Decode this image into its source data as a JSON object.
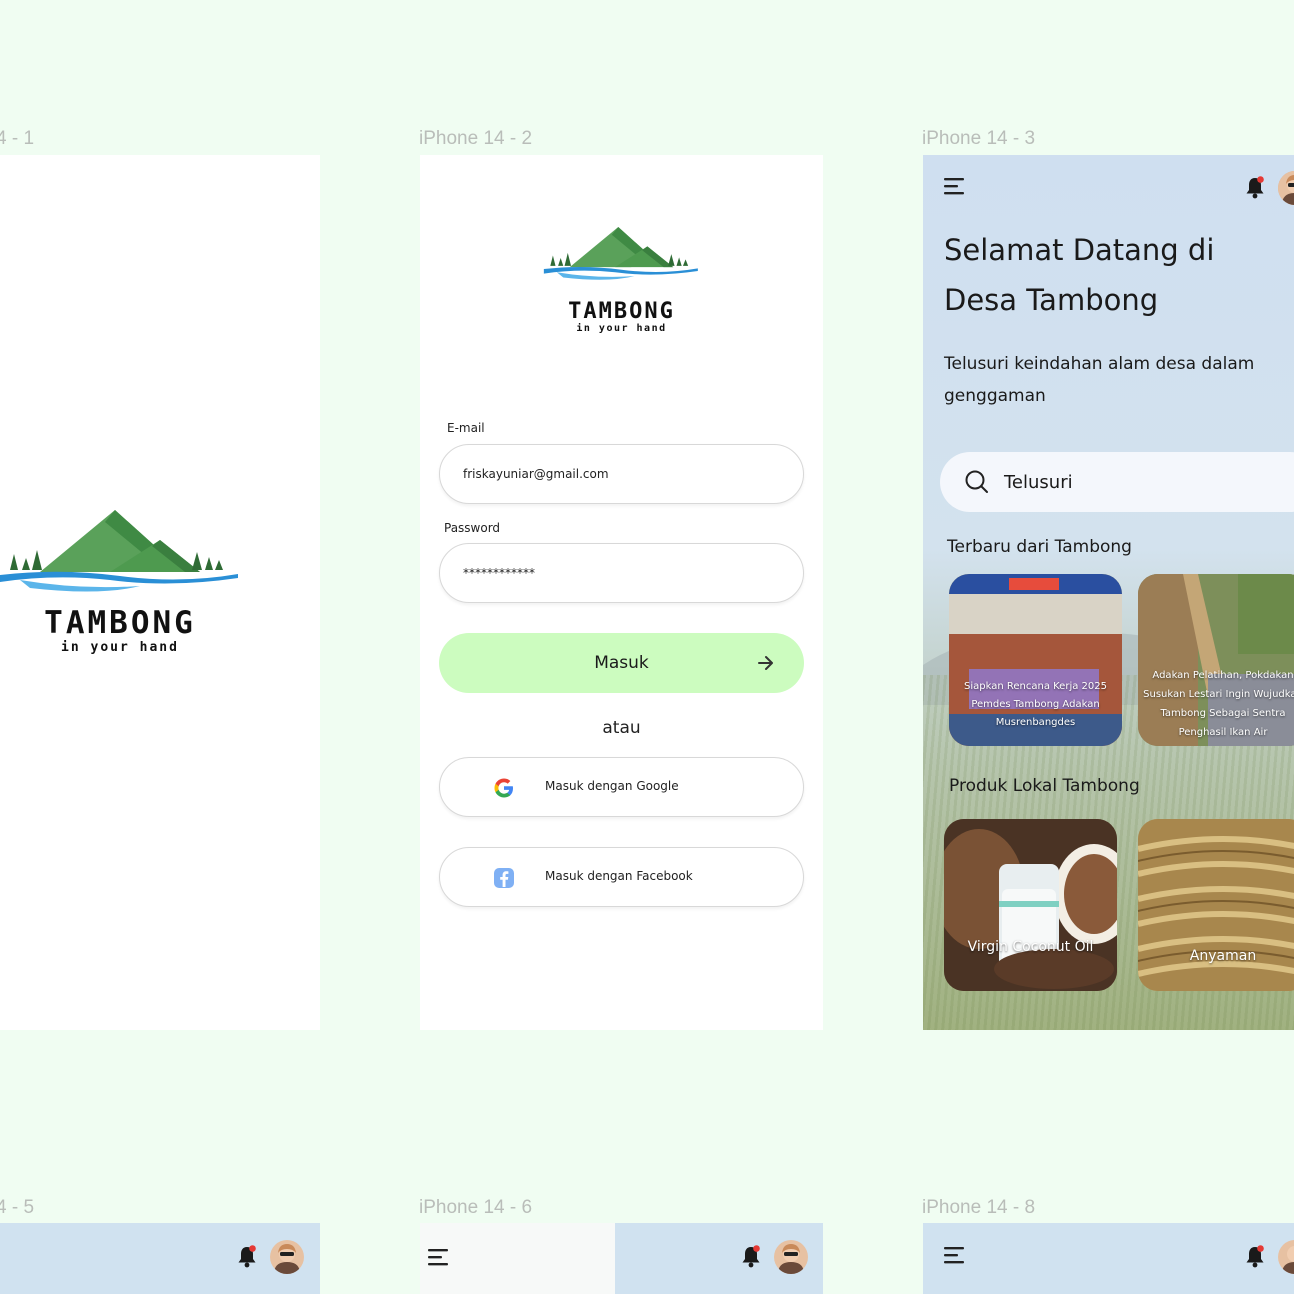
{
  "frames": {
    "f1_label": "4 - 1",
    "f2_label": "iPhone 14 - 2",
    "f3_label": "iPhone 14 - 3",
    "f5_label": "4 - 5",
    "f6_label": "iPhone 14 - 6",
    "f8_label": "iPhone 14 - 8"
  },
  "logo": {
    "word": "TAMBONG",
    "tagline": "in your hand"
  },
  "login": {
    "email_label": "E-mail",
    "email_value": "friskayuniar@gmail.com",
    "password_label": "Password",
    "password_value": "************",
    "submit_label": "Masuk",
    "or_label": "atau",
    "google_label": "Masuk dengan Google",
    "facebook_label": "Masuk dengan Facebook"
  },
  "home": {
    "welcome_title": "Selamat Datang di Desa Tambong",
    "subtitle": "Telusuri keindahan alam desa dalam genggaman",
    "search_placeholder": "Telusuri",
    "news_title": "Terbaru dari Tambong",
    "news": [
      {
        "caption": "Siapkan Rencana Kerja 2025 Pemdes Tambong Adakan Musrenbangdes"
      },
      {
        "caption": "Adakan Pelatihan, Pokdakan Susukan Lestari Ingin Wujudkan Tambong Sebagai Sentra Penghasil Ikan Air"
      }
    ],
    "products_title": "Produk Lokal Tambong",
    "products": [
      {
        "caption": "Virgin Coconut Oil"
      },
      {
        "caption": "Anyaman"
      }
    ]
  },
  "colors": {
    "background": "#f0fdf2",
    "primary_button": "#ccfcbf",
    "home_bg": "#cfdff0",
    "notification_dot": "#e53935"
  },
  "icons": [
    "menu-icon",
    "bell-icon",
    "search-icon",
    "arrow-right-icon",
    "google-icon",
    "facebook-icon",
    "avatar"
  ]
}
